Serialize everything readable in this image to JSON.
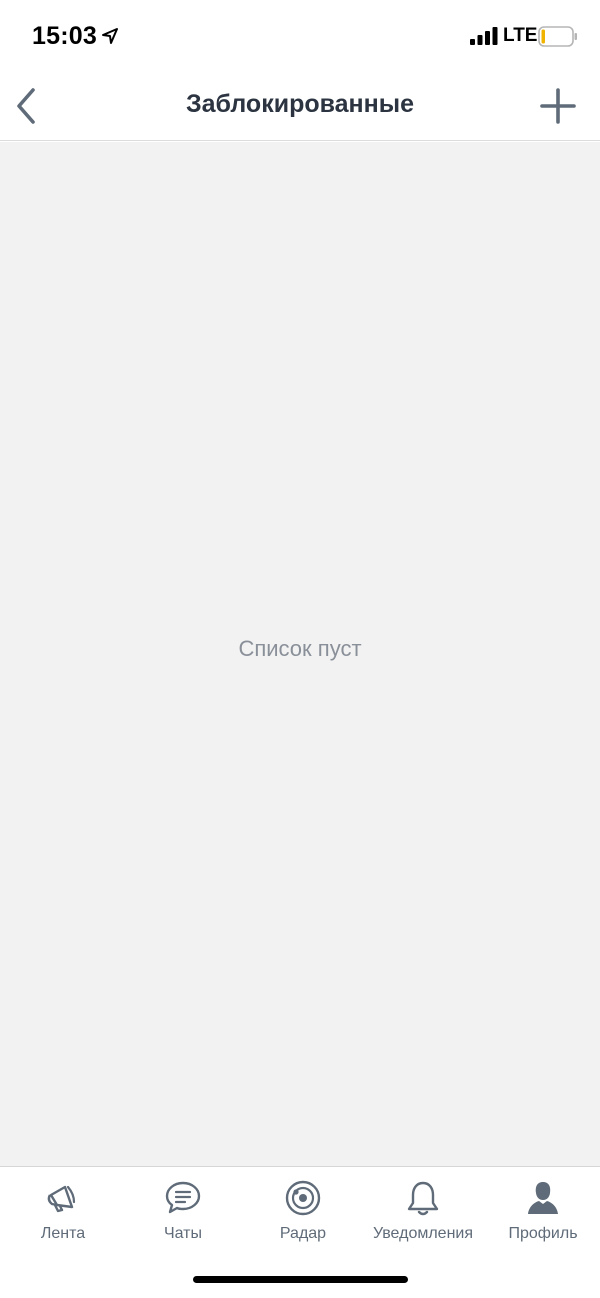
{
  "status_bar": {
    "time": "15:03",
    "network": "LTE",
    "location_icon": "location-arrow-icon",
    "signal_icon": "signal-bars-icon",
    "battery_icon": "battery-low-icon",
    "battery_color": "#f0b400"
  },
  "nav": {
    "title": "Заблокированные",
    "back_icon": "chevron-left-icon",
    "add_icon": "plus-icon"
  },
  "content": {
    "empty_text": "Список пуст",
    "background": "#f2f2f2"
  },
  "tabs": [
    {
      "label": "Лента",
      "icon": "megaphone-icon"
    },
    {
      "label": "Чаты",
      "icon": "chat-bubble-icon"
    },
    {
      "label": "Радар",
      "icon": "radar-icon"
    },
    {
      "label": "Уведомления",
      "icon": "bell-icon"
    },
    {
      "label": "Профиль",
      "icon": "person-icon",
      "active": true
    }
  ],
  "colors": {
    "accent": "#5f6b78",
    "title": "#2b3440",
    "muted": "#8a9099"
  }
}
